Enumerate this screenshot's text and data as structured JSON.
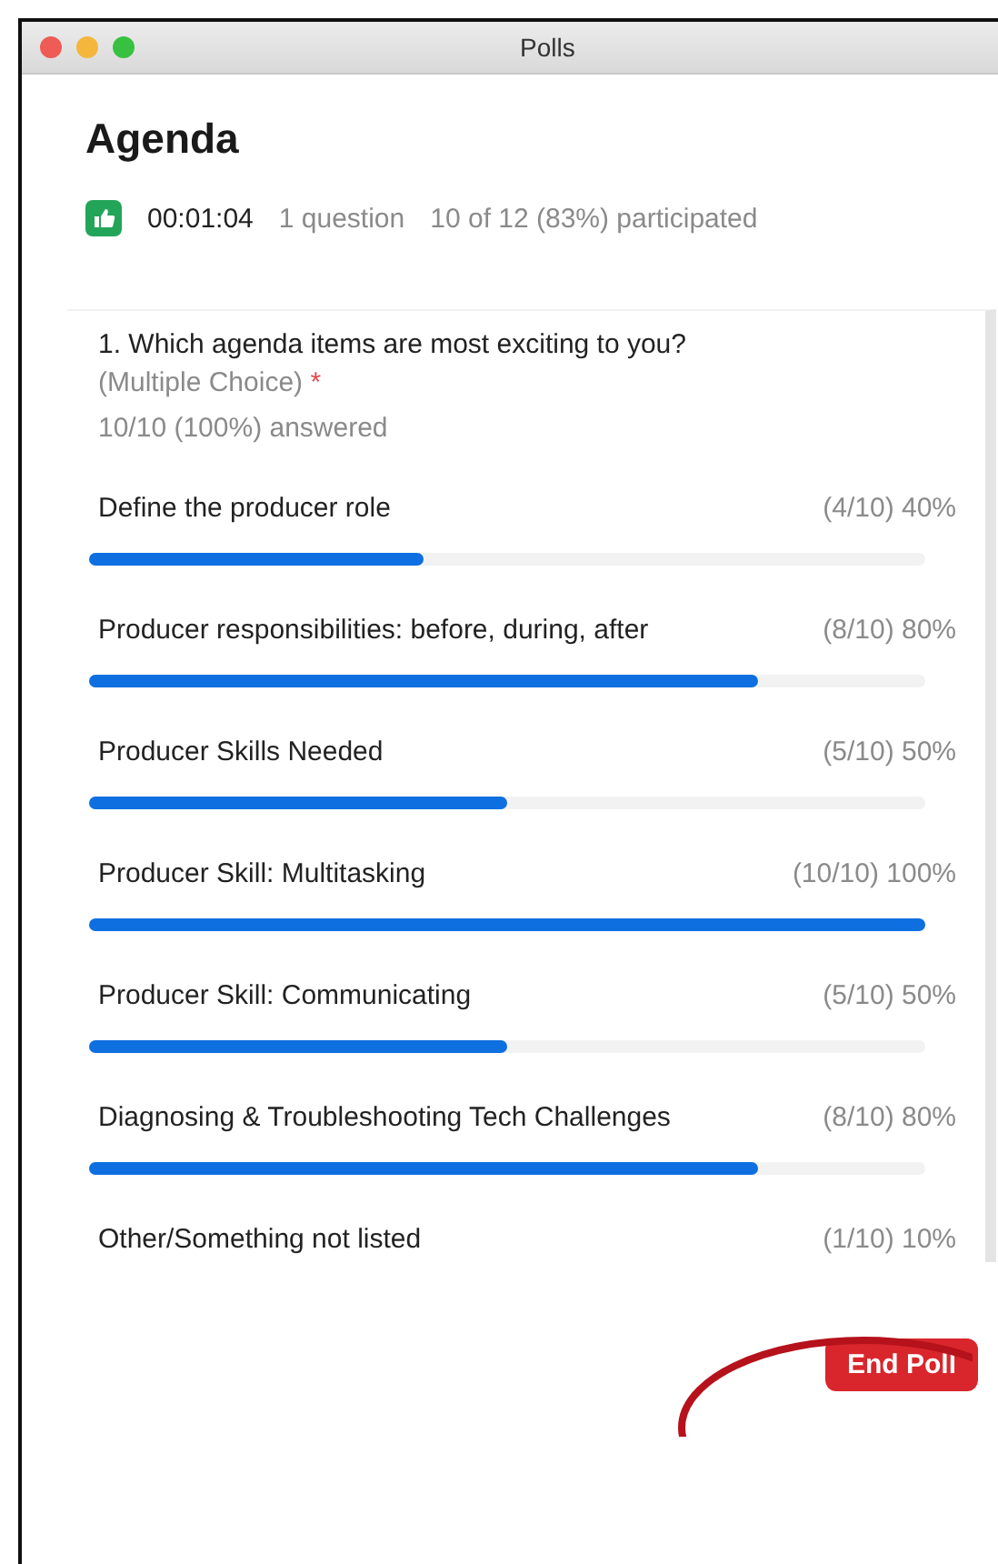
{
  "window": {
    "title": "Polls"
  },
  "poll": {
    "title": "Agenda",
    "timer": "00:01:04",
    "questions": "1 question",
    "participation": "10 of 12 (83%) participated"
  },
  "question": {
    "text": "1. Which agenda items are most exciting to you?",
    "type": "(Multiple Choice)",
    "required_mark": "*",
    "answered": "10/10 (100%) answered"
  },
  "options": [
    {
      "label": "Define the producer role",
      "result": "(4/10) 40%",
      "level": 0.4
    },
    {
      "label": "Producer responsibilities: before, during, after",
      "result": "(8/10) 80%",
      "level": 0.8
    },
    {
      "label": "Producer Skills Needed",
      "result": "(5/10) 50%",
      "level": 0.5
    },
    {
      "label": "Producer Skill: Multitasking",
      "result": "(10/10) 100%",
      "level": 1
    },
    {
      "label": "Producer Skill: Communicating",
      "result": "(5/10) 50%",
      "level": 0.5
    },
    {
      "label": "Diagnosing & Troubleshooting Tech Challenges",
      "result": "(8/10) 80%",
      "level": 0.8
    },
    {
      "label": "Other/Something not listed",
      "result": "(1/10) 10%"
    }
  ],
  "buttons": [
    {
      "label": "End Poll",
      "kind": "danger"
    }
  ]
}
